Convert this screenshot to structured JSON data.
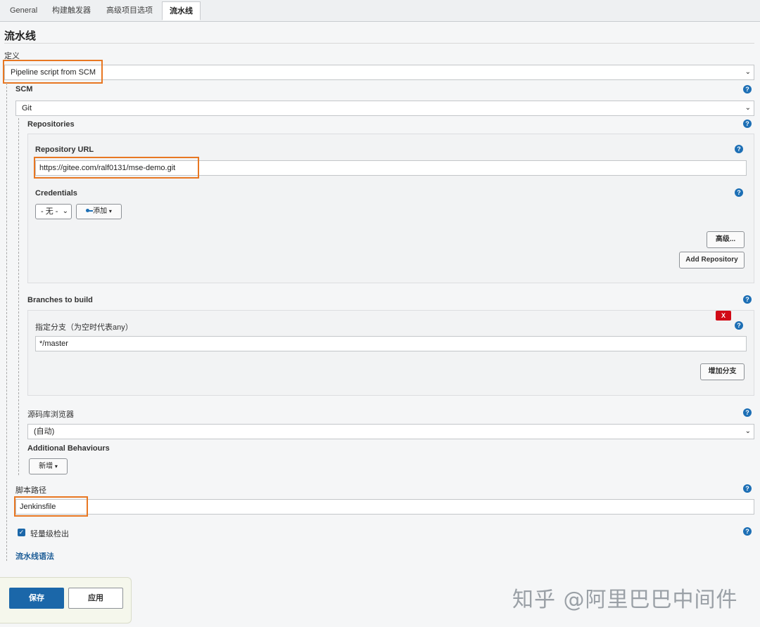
{
  "tabs": [
    "General",
    "构建触发器",
    "高级项目选项",
    "流水线"
  ],
  "section_title": "流水线",
  "definition": {
    "label": "定义",
    "value": "Pipeline script from SCM"
  },
  "scm": {
    "label": "SCM",
    "value": "Git"
  },
  "repositories": {
    "label": "Repositories",
    "url_label": "Repository URL",
    "url_value": "https://gitee.com/ralf0131/mse-demo.git",
    "credentials_label": "Credentials",
    "credentials_value": "- 无 -",
    "add_label": "添加",
    "advanced_label": "高级...",
    "add_repo_label": "Add Repository"
  },
  "branches": {
    "label": "Branches to build",
    "spec_label": "指定分支（为空时代表any）",
    "spec_value": "*/master",
    "remove_label": "X",
    "add_branch_label": "增加分支"
  },
  "browser": {
    "label": "源码库浏览器",
    "value": "(自动)"
  },
  "behaviours": {
    "label": "Additional Behaviours",
    "add_label": "新增"
  },
  "script_path": {
    "label": "脚本路径",
    "value": "Jenkinsfile"
  },
  "lightweight": {
    "label": "轻量级检出",
    "checked": true
  },
  "syntax_link": "流水线语法",
  "buttons": {
    "save": "保存",
    "apply": "应用"
  },
  "watermark": "知乎 @阿里巴巴中间件",
  "icons": {
    "help": "?",
    "check": "✓",
    "chevron": "⌄",
    "caret": "▾",
    "key": "key-icon"
  },
  "colors": {
    "accent": "#1b67a9",
    "highlight": "#e87722",
    "danger": "#d10a16"
  }
}
